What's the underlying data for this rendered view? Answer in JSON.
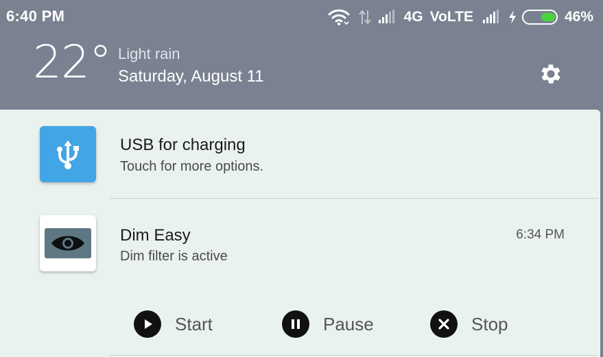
{
  "status_bar": {
    "time": "6:40 PM",
    "network_type": "4G",
    "volte": "VoLTE",
    "battery_percent": "46%",
    "battery_level": 0.46,
    "icons": [
      "wifi-icon",
      "data-arrows-icon",
      "signal-icon",
      "charging-bolt-icon",
      "battery-icon"
    ]
  },
  "weather": {
    "temperature": "22°",
    "condition": "Light rain",
    "date": "Saturday, August 11"
  },
  "notifications": [
    {
      "app": "usb",
      "title": "USB for charging",
      "subtitle": "Touch for more options.",
      "icon": "usb-icon",
      "icon_color": "#42a5e5"
    },
    {
      "app": "dim-easy",
      "title": "Dim Easy",
      "subtitle": "Dim filter is active",
      "time": "6:34 PM",
      "icon": "eye-icon",
      "actions": [
        {
          "label": "Start",
          "icon": "play-icon"
        },
        {
          "label": "Pause",
          "icon": "pause-icon"
        },
        {
          "label": "Stop",
          "icon": "close-icon"
        }
      ]
    }
  ],
  "colors": {
    "shade": "#7a8291",
    "panel": "#eaf2f0",
    "battery_fill": "#4bd43b"
  }
}
